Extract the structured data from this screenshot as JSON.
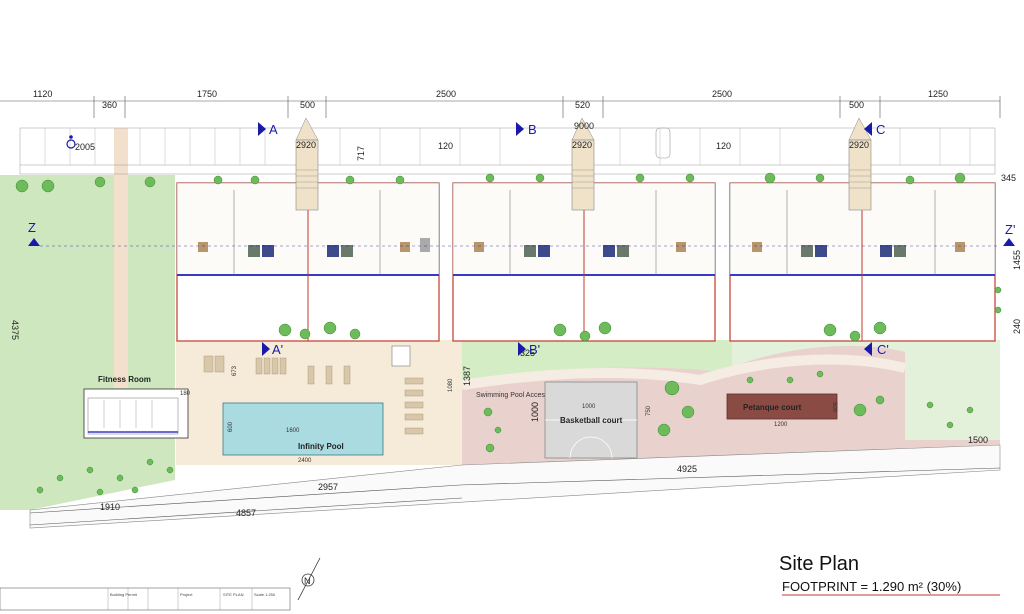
{
  "plan": {
    "title": "Site Plan",
    "footprint": "FOOTPRINT = 1.290  m²  (30%)",
    "areas": {
      "fitness_room": "Fitness Room",
      "infinity_pool": "Infinity Pool",
      "swimming_pool_access": "Swimming Pool Acces",
      "basketball_court": "Basketball court",
      "petanque_court": "Petanque court"
    },
    "section_markers": {
      "a": "A",
      "a_prime": "A'",
      "b": "B",
      "b_prime": "B'",
      "c": "C",
      "c_prime": "C'",
      "z": "Z",
      "z_prime": "Z'"
    },
    "top_dimensions": [
      "1120",
      "360",
      "1750",
      "500",
      "2500",
      "520",
      "2500",
      "500",
      "1250"
    ],
    "dimensions": {
      "d2005": "2005",
      "d9000": "9000",
      "d2920a": "2920",
      "d2920b": "2920",
      "d2920c": "2920",
      "d717": "717",
      "d120a": "120",
      "d120b": "120",
      "d345": "345",
      "d1455": "1455",
      "d240": "240",
      "d4375": "4375",
      "d673": "673",
      "d180": "180",
      "d1080": "1080",
      "d1387": "1387",
      "d1000_court_top": "1000",
      "d1000_court_side": "1000",
      "d750": "750",
      "d500": "500",
      "d1200": "1200",
      "d1500_right": "1500",
      "d325": "325",
      "d1600": "1600",
      "d2400": "2400",
      "d600": "600",
      "d4925": "4925",
      "d2957": "2957",
      "d1910": "1910",
      "d4857": "4857"
    },
    "north": "N",
    "title_block": [
      "Building Permit",
      "SITE PLAN",
      "Project",
      "Scale 1:250"
    ]
  },
  "colors": {
    "building_outline": "#c0392b",
    "balcony_blue": "#3a3ac8",
    "lawn": "#cfe7bf",
    "grass_dark": "#6dbb5a",
    "terrace": "#f6ead9",
    "pink_zone": "#e9d2cd",
    "court_grey": "#d9d9d9",
    "pool": "#a9dbe0",
    "petanque": "#8b4b45",
    "marker_blue": "#1a1aa8"
  }
}
